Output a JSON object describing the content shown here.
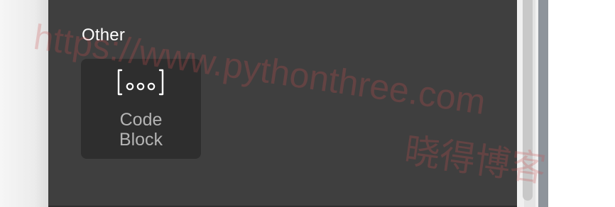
{
  "section": {
    "title": "Other"
  },
  "blocks": [
    {
      "label": "Code\nBlock",
      "icon": "code-block-icon"
    }
  ],
  "watermark": {
    "url": "https://www.pythonthree.com",
    "chinese": "晓得博客"
  },
  "colors": {
    "panel_background": "#3f3f3f",
    "tile_background": "#2e2e2e",
    "title_text": "#ffffff",
    "tile_text": "#b4b4b4",
    "watermark": "#cd5050"
  }
}
